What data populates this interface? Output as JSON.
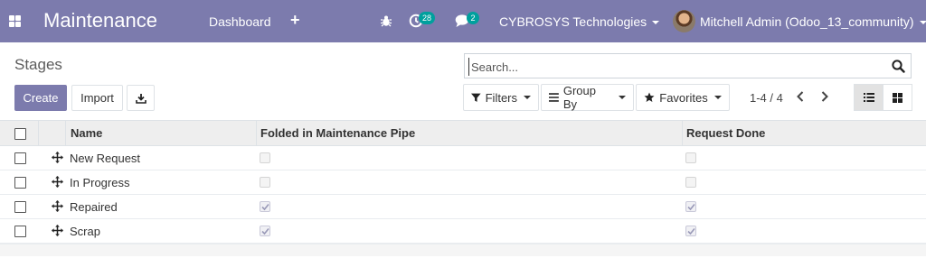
{
  "navbar": {
    "app_title": "Maintenance",
    "menu_dashboard": "Dashboard",
    "menu_add": "+",
    "activity_count": "28",
    "chat_count": "2",
    "company": "CYBROSYS Technologies",
    "user": "Mitchell Admin (Odoo_13_community)",
    "bg_color": "#7c7bad",
    "badge_color": "#00a09d"
  },
  "control_panel": {
    "breadcrumb": "Stages",
    "search_placeholder": "Search...",
    "create_label": "Create",
    "import_label": "Import",
    "filters_label": "Filters",
    "groupby_label": "Group By",
    "favorites_label": "Favorites",
    "pager": "1-4 / 4"
  },
  "table": {
    "columns": [
      "Name",
      "Folded in Maintenance Pipe",
      "Request Done"
    ],
    "rows": [
      {
        "name": "New Request",
        "folded": false,
        "done": false
      },
      {
        "name": "In Progress",
        "folded": false,
        "done": false
      },
      {
        "name": "Repaired",
        "folded": true,
        "done": true
      },
      {
        "name": "Scrap",
        "folded": true,
        "done": true
      }
    ]
  },
  "icons": {
    "apps": "apps-grid-icon",
    "debug": "bug-icon",
    "activity": "clock-icon",
    "chat": "chat-bubble-icon",
    "search": "magnifier-icon",
    "download": "download-icon",
    "filter": "funnel-icon",
    "groupby": "bars-icon",
    "favorites": "star-icon",
    "prev": "chevron-left-icon",
    "next": "chevron-right-icon",
    "list_view": "list-icon",
    "kanban_view": "grid-icon",
    "handle": "arrows-move-icon"
  }
}
